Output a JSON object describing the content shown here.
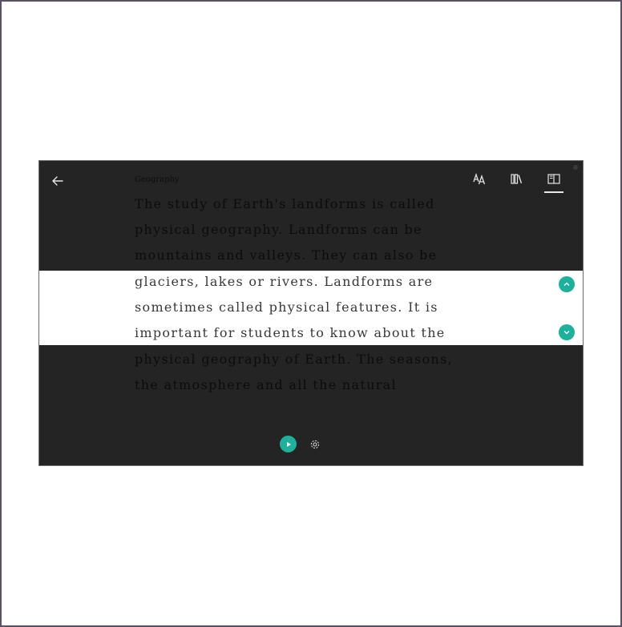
{
  "reader": {
    "subject": "Geography",
    "lines": [
      "The study of Earth's landforms is called",
      "physical geography. Landforms can be",
      "mountains and valleys. They can also be",
      "glaciers, lakes or rivers. Landforms are",
      "sometimes called physical features. It is",
      "important for students to know about the",
      "physical geography of Earth. The seasons,",
      "the atmosphere and all the natural"
    ],
    "focused_lines": [
      3,
      4,
      5
    ]
  },
  "toolbar": {
    "icons": [
      "text-options-icon",
      "library-icon",
      "reading-preferences-icon"
    ],
    "active": "reading-preferences-icon"
  },
  "controls": {
    "icons": [
      "play-icon",
      "gear-icon"
    ]
  },
  "colors": {
    "accent": "#1fb09b",
    "background": "#242424",
    "focus_band": "#ffffff"
  }
}
